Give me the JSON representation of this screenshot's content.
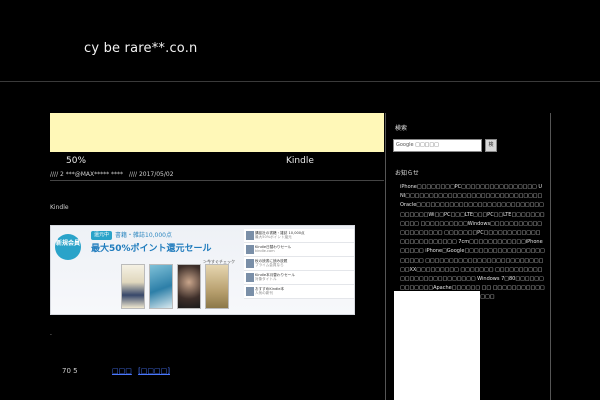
{
  "header": {
    "site_title": "cy be rare**.co.n"
  },
  "post": {
    "title_left": "50%",
    "title_right": "Kindle",
    "meta": [
      "//// 2 ***@MAX***** ****",
      "//// 2017/05/02"
    ],
    "section_label": "Kindle"
  },
  "banner": {
    "badge": "新規会員",
    "pill": "還元中",
    "headline_sub": "書籍・雑誌10,000点",
    "headline_main": "最大50%ポイント還元セール",
    "note": "＞今すぐチェック",
    "list": [
      {
        "title": "講談社の書籍・雑誌 10,000点",
        "sub": "最大50%ポイント還元"
      },
      {
        "title": "Kindle日替わりセール",
        "sub": "kindle.com"
      },
      {
        "title": "秋の読書に読み放題",
        "sub": "プライム会員なら"
      },
      {
        "title": "Kindle本月替わりセール",
        "sub": "対象タイトル"
      },
      {
        "title": "おすすめKindle本",
        "sub": "人気の新刊"
      }
    ]
  },
  "footer": {
    "number": "70 5",
    "links": [
      "□□□",
      "[□□□□]"
    ]
  },
  "sidebar": {
    "search_title": "検索",
    "search_placeholder": "Google □□□□□",
    "search_button": "検",
    "info_title": "お知らせ",
    "info_text": "iPhone□□□□□□□□PC□□□□□□□□□□□□□□□□ UNI□□□□□□□□□□□□□□□□□□□□□□□□□□□□□ Oracle□□□□□□□□□□□□□□□□□□□□□□□□□□□ □□□□□□Wi□□PC□□□LTE□□□PC□□LTE□□□□□□□□□□□ □□□□□□□□□□Windows□□□□□□□□□□□□□□□□□□□□ □□□□□□□PC□□□□□□□□□□□□□□□□□□□□□□□□ 7cm□□□□□□□□□□□□iPhone□□□□□ iPhone□Google□□□□□□□□□□□□□□□□□□□□□□ □□□□□□□□□□□□□□□□□□□□□□□□□□□XX□□□□□□□□□ □□□□□□□ □□□□□□□□□□□□□□□□□□□□□□□□□□ Windows 7□80□□□□□□□□□□□□□Apache□□□□□□ □□ □□□□□□□□□□□□□□□□□□□□□□□□□□□□□□□"
  },
  "colors": {
    "background": "#000000",
    "ad_banner": "#fff8b8",
    "link": "#4a78ff",
    "promo_accent": "#2aa3c9"
  }
}
